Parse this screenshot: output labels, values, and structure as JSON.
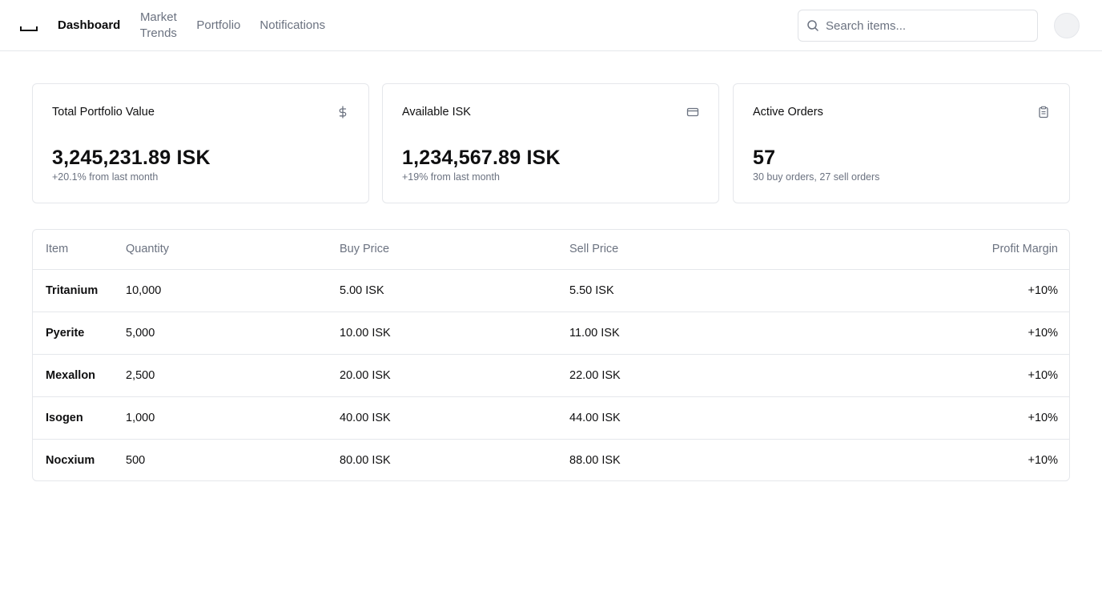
{
  "nav": {
    "items": [
      {
        "label": "Dashboard",
        "active": true
      },
      {
        "label": "Market Trends",
        "active": false
      },
      {
        "label": "Portfolio",
        "active": false
      },
      {
        "label": "Notifications",
        "active": false
      }
    ]
  },
  "search": {
    "placeholder": "Search items...",
    "value": ""
  },
  "cards": [
    {
      "title": "Total Portfolio Value",
      "icon": "dollar-icon",
      "value": "3,245,231.89 ISK",
      "sub": "+20.1% from last month"
    },
    {
      "title": "Available ISK",
      "icon": "credit-card-icon",
      "value": "1,234,567.89 ISK",
      "sub": "+19% from last month"
    },
    {
      "title": "Active Orders",
      "icon": "clipboard-icon",
      "value": "57",
      "sub": "30 buy orders, 27 sell orders"
    }
  ],
  "table": {
    "headers": [
      "Item",
      "Quantity",
      "Buy Price",
      "Sell Price",
      "Profit Margin"
    ],
    "rows": [
      [
        "Tritanium",
        "10,000",
        "5.00 ISK",
        "5.50 ISK",
        "+10%"
      ],
      [
        "Pyerite",
        "5,000",
        "10.00 ISK",
        "11.00 ISK",
        "+10%"
      ],
      [
        "Mexallon",
        "2,500",
        "20.00 ISK",
        "22.00 ISK",
        "+10%"
      ],
      [
        "Isogen",
        "1,000",
        "40.00 ISK",
        "44.00 ISK",
        "+10%"
      ],
      [
        "Nocxium",
        "500",
        "80.00 ISK",
        "88.00 ISK",
        "+10%"
      ]
    ]
  },
  "colors": {
    "text": "#0f0f10",
    "muted": "#6b7280",
    "border": "#e5e7eb"
  }
}
